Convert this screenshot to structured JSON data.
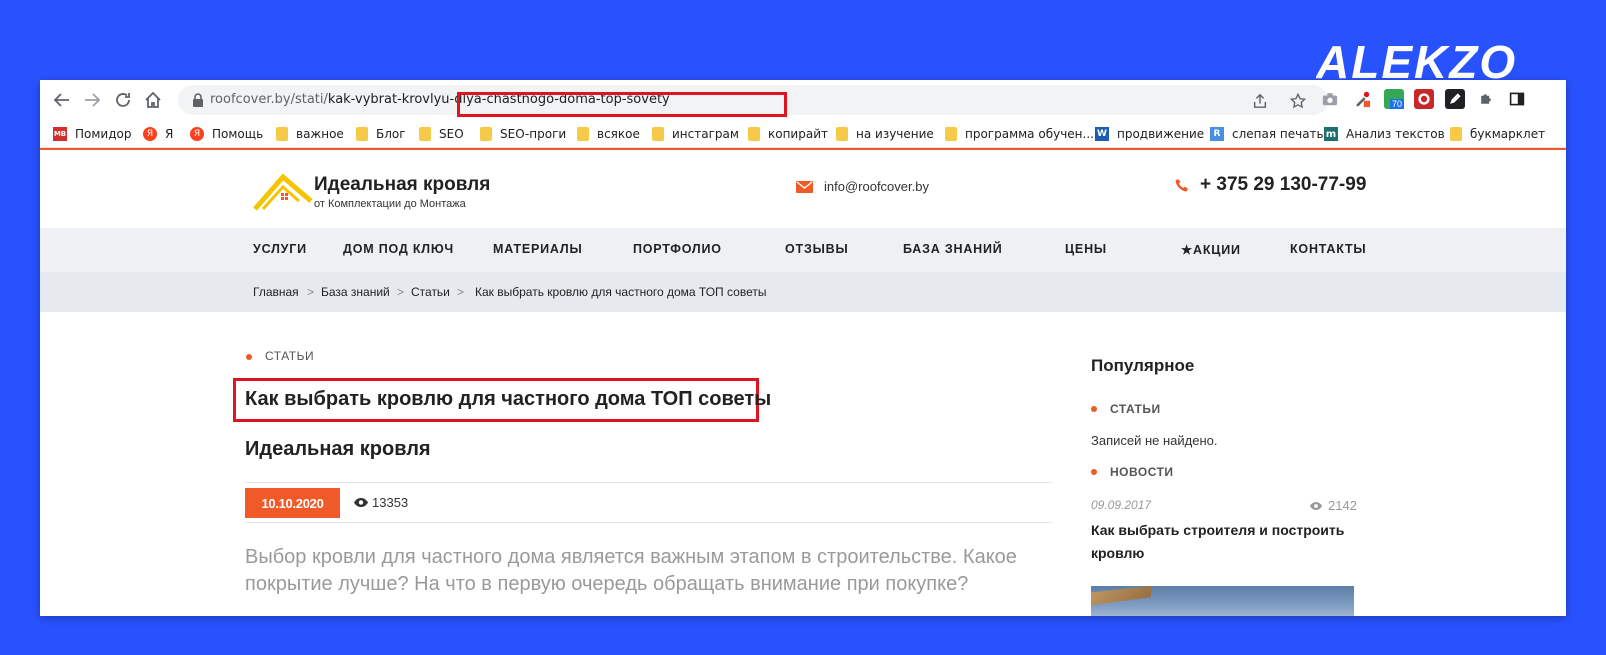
{
  "brand": {
    "logo_text": "ALEKZO"
  },
  "browser": {
    "url_host": "roofcover.by",
    "url_path": "/stati/",
    "url_slug": "kak-vybrat-krovlyu-dlya-chastnogo-doma-top-sovety",
    "extension_badge": "70"
  },
  "bookmarks": [
    {
      "label": "Помидор",
      "icon": "mb-icon"
    },
    {
      "label": "Я",
      "icon": "yandex-icon"
    },
    {
      "label": "Помощь",
      "icon": "yandex-icon"
    },
    {
      "label": "важное",
      "icon": "folder-icon"
    },
    {
      "label": "Блог",
      "icon": "folder-icon"
    },
    {
      "label": "SEO",
      "icon": "folder-icon"
    },
    {
      "label": "SEO-проги",
      "icon": "folder-icon"
    },
    {
      "label": "всякое",
      "icon": "folder-icon"
    },
    {
      "label": "инстаграм",
      "icon": "folder-icon"
    },
    {
      "label": "копирайт",
      "icon": "folder-icon"
    },
    {
      "label": "на изучение",
      "icon": "folder-icon"
    },
    {
      "label": "программа обучен...",
      "icon": "folder-icon"
    },
    {
      "label": "продвижение",
      "icon": "word-icon"
    },
    {
      "label": "слепая печать",
      "icon": "r-icon"
    },
    {
      "label": "Анализ текстов",
      "icon": "m-icon"
    },
    {
      "label": "букмарклет",
      "icon": "folder-icon"
    }
  ],
  "site": {
    "logo_title": "Идеальная кровля",
    "logo_subtitle": "от Комплектации до Монтажа",
    "email": "info@roofcover.by",
    "phone": "+ 375 29 130-77-99",
    "menu": [
      "УСЛУГИ",
      "ДОМ ПОД КЛЮЧ",
      "МАТЕРИАЛЫ",
      "ПОРТФОЛИО",
      "ОТЗЫВЫ",
      "БАЗА ЗНАНИЙ",
      "ЦЕНЫ",
      "★АКЦИИ",
      "КОНТАКТЫ"
    ],
    "breadcrumbs": [
      "Главная",
      "База знаний",
      "Статьи",
      "Как выбрать кровлю для частного дома ТОП советы"
    ],
    "breadcrumb_separator": ">"
  },
  "article": {
    "category": "СТАТЬИ",
    "title": "Как выбрать кровлю для частного дома ТОП советы",
    "author": "Идеальная кровля",
    "date": "10.10.2020",
    "views": "13353",
    "intro": "Выбор кровли для частного дома является важным этапом в строительстве. Какое покрытие лучше? На что в первую очередь обращать внимание при покупке?"
  },
  "sidebar": {
    "title": "Популярное",
    "cat1": "СТАТЬИ",
    "empty_text": "Записей не найдено.",
    "cat2": "НОВОСТИ",
    "post_date": "09.09.2017",
    "post_views": "2142",
    "post_title": "Как выбрать строителя и построить кровлю"
  },
  "colors": {
    "accent": "#f05a28",
    "highlight": "#e0141e",
    "background": "#2952ff"
  }
}
